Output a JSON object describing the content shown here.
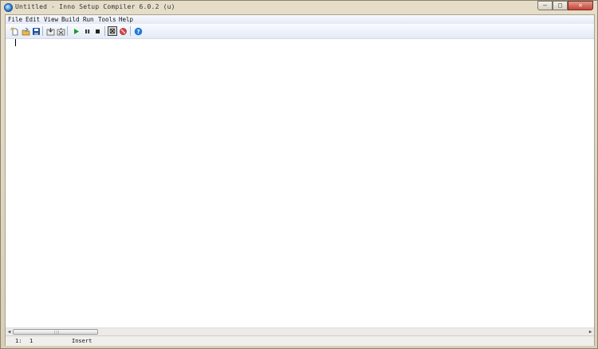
{
  "window": {
    "title": "Untitled - Inno Setup Compiler 6.0.2 (u)",
    "controls": {
      "minimize": "–",
      "maximize": "□",
      "close": "✕"
    }
  },
  "menubar": {
    "items": [
      "File",
      "Edit",
      "View",
      "Build",
      "Run",
      "Tools",
      "Help"
    ]
  },
  "toolbar": {
    "buttons": [
      {
        "icon": "new-file-icon"
      },
      {
        "icon": "open-folder-icon"
      },
      {
        "icon": "save-icon"
      },
      {
        "icon": "compile-icon"
      },
      {
        "icon": "stop-compile-icon"
      },
      {
        "icon": "run-icon"
      },
      {
        "icon": "pause-icon"
      },
      {
        "icon": "stop-icon"
      },
      {
        "icon": "debug-output-icon",
        "pressed": true
      },
      {
        "icon": "debug-call-stack-icon"
      },
      {
        "icon": "help-icon"
      }
    ],
    "colors": {
      "run": "#1a9a2a",
      "help": "#1f7ad8",
      "save": "#1c4fa0"
    }
  },
  "editor": {
    "content": ""
  },
  "scrollbar": {
    "left_arrow": "◀",
    "right_arrow": "▶",
    "grip": "|||"
  },
  "statusbar": {
    "line": "1:",
    "column": "1",
    "mode": "Insert"
  }
}
